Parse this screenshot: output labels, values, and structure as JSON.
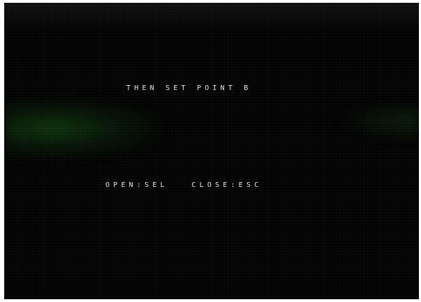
{
  "screen": {
    "instruction": "THEN SET POINT B",
    "controls": "OPEN:SEL   CLOSE:ESC"
  },
  "colors": {
    "background": "#040404",
    "text": "#e6e6e6",
    "glow": "#165a16"
  }
}
